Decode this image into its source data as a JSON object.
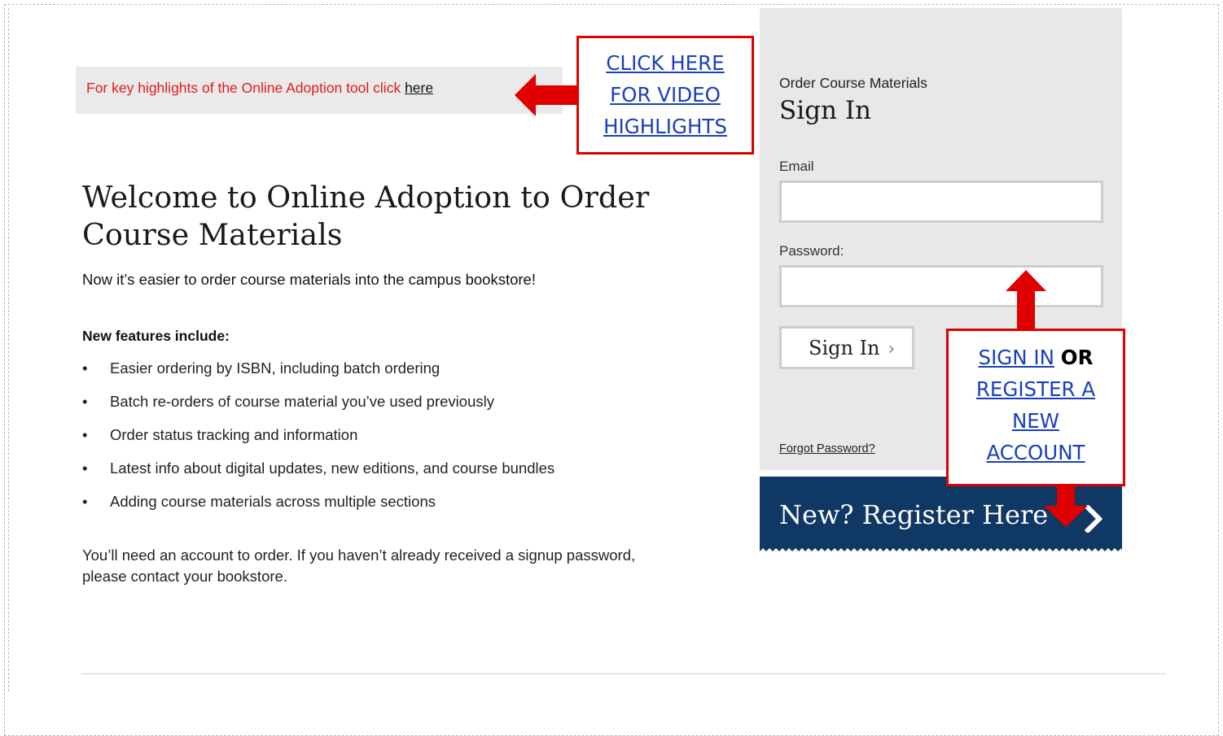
{
  "banner": {
    "text": "For key highlights of the Online Adoption tool click ",
    "link": "here"
  },
  "callouts": {
    "video": [
      "CLICK HERE",
      "FOR VIDEO",
      "HIGHLIGHTS"
    ],
    "signin": {
      "link1": "SIGN IN",
      "or": "OR",
      "link2_lines": [
        "REGISTER A",
        "NEW",
        "ACCOUNT"
      ]
    }
  },
  "main": {
    "heading": "Welcome to Online Adoption to Order Course Materials",
    "intro": "Now it’s easier to order course materials into the campus bookstore!",
    "features_heading": "New features include:",
    "features": [
      "Easier ordering by ISBN, including batch ordering",
      "Batch re-orders of course material you’ve used previously",
      "Order status tracking and information",
      "Latest info about digital updates, new editions, and course bundles",
      "Adding course materials across multiple sections"
    ],
    "bullet": "•",
    "account_note": "You’ll need an account to order. If you haven’t already received a signup password, please contact your bookstore."
  },
  "signin_panel": {
    "subtitle": "Order Course Materials",
    "title": "Sign In",
    "email_label": "Email",
    "email_value": "",
    "password_label": "Password:",
    "password_value": "",
    "button_label": "Sign In",
    "button_chevron": "›",
    "forgot_link": "Forgot Password?"
  },
  "register": {
    "label": "New? Register Here"
  },
  "colors": {
    "annotation_red": "#e00000",
    "link_blue": "#1b3fbb",
    "register_navy": "#0f3864",
    "panel_gray": "#e8e8e8",
    "banner_red_text": "#e31b1b"
  }
}
